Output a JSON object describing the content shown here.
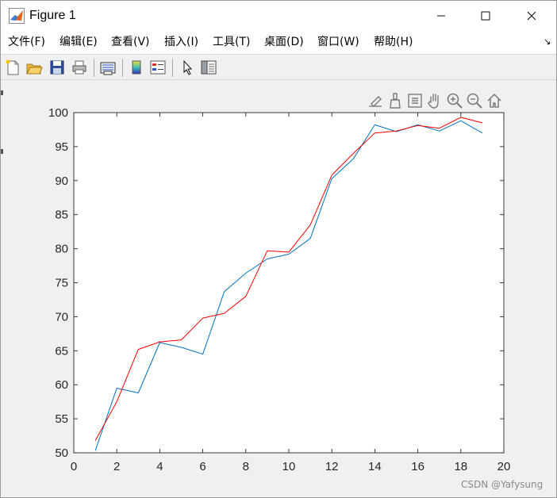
{
  "window": {
    "title": "Figure 1",
    "min_glyph": "—",
    "max_glyph": "☐",
    "close_glyph": "✕"
  },
  "menu": {
    "items": [
      "文件(F)",
      "编辑(E)",
      "查看(V)",
      "插入(I)",
      "工具(T)",
      "桌面(D)",
      "窗口(W)",
      "帮助(H)"
    ],
    "expand_glyph": "↘"
  },
  "toolbar": {
    "buttons": [
      "new-figure-icon",
      "open-file-icon",
      "save-icon",
      "print-icon",
      "link-plot-icon",
      "colorbar-icon",
      "legend-icon",
      "pointer-icon",
      "property-inspector-icon"
    ]
  },
  "axes_toolbar": {
    "buttons": [
      "edit-icon",
      "brush-icon",
      "data-tips-icon",
      "pan-icon",
      "zoom-in-icon",
      "zoom-out-icon",
      "home-icon"
    ]
  },
  "colors": {
    "series_blue": "#0072BD",
    "series_red": "#FF0000",
    "axis": "#262626"
  },
  "chart_data": {
    "type": "line",
    "xlim": [
      0,
      20
    ],
    "ylim": [
      50,
      100
    ],
    "xticks": [
      0,
      2,
      4,
      6,
      8,
      10,
      12,
      14,
      16,
      18,
      20
    ],
    "yticks": [
      50,
      55,
      60,
      65,
      70,
      75,
      80,
      85,
      90,
      95,
      100
    ],
    "grid": false,
    "x": [
      1,
      2,
      3,
      4,
      5,
      6,
      7,
      8,
      9,
      10,
      11,
      12,
      13,
      14,
      15,
      16,
      17,
      18,
      19
    ],
    "series": [
      {
        "color": "#0072BD",
        "values": [
          50.3,
          59.5,
          58.8,
          66.2,
          65.5,
          64.5,
          73.7,
          76.4,
          78.5,
          79.2,
          81.5,
          90.3,
          93.2,
          98.2,
          97.2,
          98.2,
          97.3,
          98.8,
          97.0
        ]
      },
      {
        "color": "#FF0000",
        "values": [
          51.8,
          57.5,
          65.2,
          66.3,
          66.6,
          69.8,
          70.5,
          73.0,
          79.7,
          79.5,
          83.5,
          90.8,
          94.0,
          97.0,
          97.3,
          98.1,
          97.7,
          99.3,
          98.5
        ]
      }
    ]
  },
  "watermark": "CSDN @Yafysung"
}
